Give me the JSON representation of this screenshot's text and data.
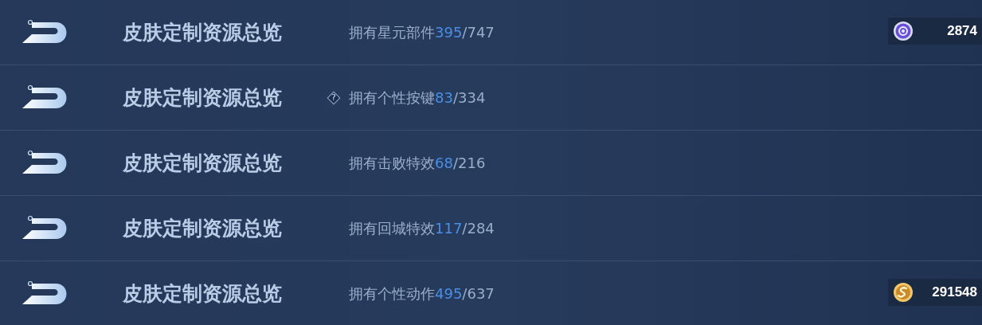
{
  "rows": [
    {
      "title": "皮肤定制资源总览",
      "label": "拥有星元部件",
      "owned": "395",
      "total": "/747",
      "currency": {
        "kind": "gem",
        "amount": "2874"
      }
    },
    {
      "title": "皮肤定制资源总览",
      "help": "?",
      "label": "拥有个性按键",
      "owned": "83",
      "total": "/334"
    },
    {
      "title": "皮肤定制资源总览",
      "label": "拥有击败特效",
      "owned": "68",
      "total": "/216"
    },
    {
      "title": "皮肤定制资源总览",
      "label": "拥有回城特效",
      "owned": "117",
      "total": "/284"
    },
    {
      "title": "皮肤定制资源总览",
      "label": "拥有个性动作",
      "owned": "495",
      "total": "/637",
      "currency": {
        "kind": "coin",
        "amount": "291548"
      }
    }
  ]
}
